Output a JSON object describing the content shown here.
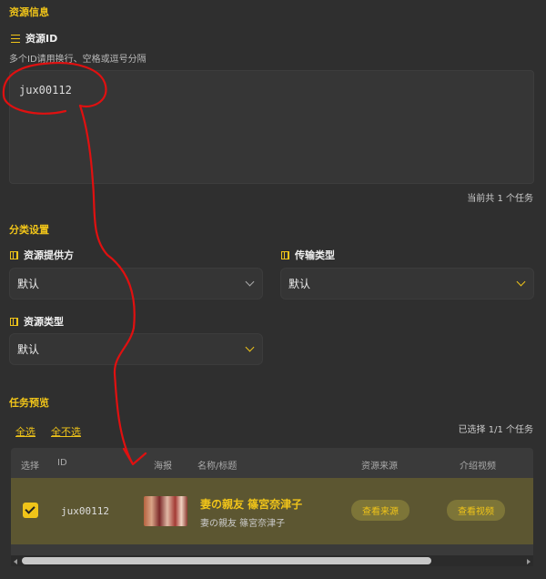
{
  "resource_info": {
    "section_title": "资源信息",
    "id_label": "资源ID",
    "id_hint": "多个ID请用换行、空格或逗号分隔",
    "id_value": "jux00112",
    "task_count": "当前共 1 个任务"
  },
  "category": {
    "section_title": "分类设置",
    "provider_label": "资源提供方",
    "provider_value": "默认",
    "transfer_label": "传输类型",
    "transfer_value": "默认",
    "type_label": "资源类型",
    "type_value": "默认"
  },
  "preview": {
    "section_title": "任务预览",
    "select_all": "全选",
    "select_none": "全不选",
    "selected_count": "已选择 1/1 个任务",
    "columns": [
      "选择",
      "ID",
      "海报",
      "名称/标题",
      "资源来源",
      "介绍视频"
    ],
    "rows": [
      {
        "checked": true,
        "id": "jux00112",
        "title": "妻の親友 篠宮奈津子",
        "subtitle": "妻の親友 篠宮奈津子",
        "source_button": "查看来源",
        "video_button": "查看视频"
      }
    ]
  },
  "colors": {
    "accent": "#f0c419",
    "background": "#2f2f2f",
    "row_highlight": "#5c5631",
    "annotation": "#e01010"
  }
}
